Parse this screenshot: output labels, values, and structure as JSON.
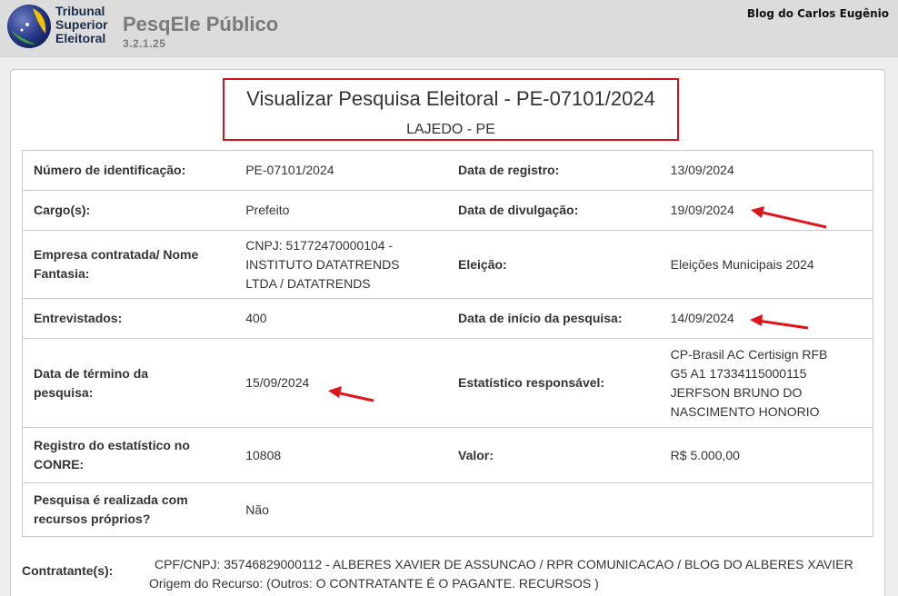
{
  "header": {
    "org_lines": [
      "Tribunal",
      "Superior",
      "Eleitoral"
    ],
    "app_title": "PesqEle Público",
    "app_version": "3.2.1.25",
    "watermark": "Blog do Carlos Eugênio"
  },
  "main": {
    "title": "Visualizar Pesquisa Eleitoral - PE-07101/2024",
    "subtitle": "LAJEDO - PE",
    "rows": [
      {
        "label1": "Número de identificação:",
        "value1": "PE-07101/2024",
        "label2": "Data de registro:",
        "value2": "13/09/2024"
      },
      {
        "label1": "Cargo(s):",
        "value1": "Prefeito",
        "label2": "Data de divulgação:",
        "value2": "19/09/2024"
      },
      {
        "label1": "Empresa contratada/ Nome Fantasia:",
        "value1": "CNPJ: 51772470000104 - INSTITUTO DATATRENDS LTDA / DATATRENDS",
        "label2": "Eleição:",
        "value2": "Eleições Municipais 2024"
      },
      {
        "label1": "Entrevistados:",
        "value1": "400",
        "label2": "Data de início da pesquisa:",
        "value2": "14/09/2024"
      },
      {
        "label1": "Data de término da pesquisa:",
        "value1": "15/09/2024",
        "label2": "Estatístico responsável:",
        "value2": "CP-Brasil AC Certisign RFB G5 A1 17334115000115 JERFSON BRUNO DO NASCIMENTO HONORIO"
      },
      {
        "label1": "Registro do estatístico no CONRE:",
        "value1": "10808",
        "label2": "Valor:",
        "value2": "R$ 5.000,00"
      },
      {
        "label1": "Pesquisa é realizada com recursos próprios?",
        "value1": "Não",
        "label2": "",
        "value2": ""
      }
    ],
    "contratante_label": "Contratante(s):",
    "contratante_value": "CPF/CNPJ: 35746829000112 - ALBERES XAVIER DE ASSUNCAO / RPR COMUNICACAO / BLOG DO ALBERES XAVIER Origem do Recurso: (Outros: O CONTRATANTE É O PAGANTE. RECURSOS )"
  },
  "colors": {
    "highlight_box": "#d0141b",
    "arrow": "#e0141b",
    "header_bg": "#dcdcdc"
  },
  "icons": {
    "logo": "tse-globe-logo",
    "annotations": "red-arrow-icon"
  }
}
